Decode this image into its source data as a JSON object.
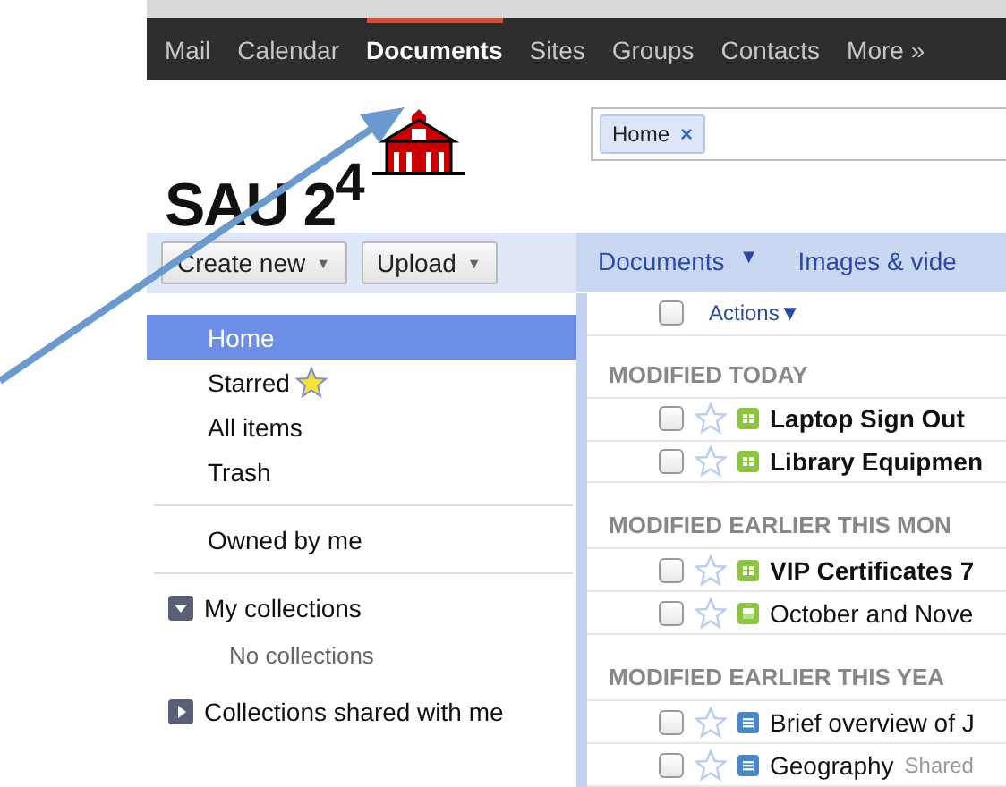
{
  "nav": {
    "items": [
      {
        "label": "Mail",
        "selected": false
      },
      {
        "label": "Calendar",
        "selected": false
      },
      {
        "label": "Documents",
        "selected": true
      },
      {
        "label": "Sites",
        "selected": false
      },
      {
        "label": "Groups",
        "selected": false
      },
      {
        "label": "Contacts",
        "selected": false
      },
      {
        "label": "More »",
        "selected": false
      }
    ]
  },
  "logo": {
    "text": "SAU 2$^{4}$"
  },
  "search": {
    "chip": "Home",
    "chip_close": "×"
  },
  "toolbar": {
    "buttons": [
      "Create new",
      "Upload"
    ],
    "caret": "▼"
  },
  "view_tabs": [
    {
      "label": "Documents",
      "caret": "▼"
    },
    {
      "label": "Images & vide"
    }
  ],
  "sidebar": {
    "items": [
      {
        "kind": "item",
        "label": "Home",
        "selected": true
      },
      {
        "kind": "item",
        "label": "Starred",
        "selected": false,
        "star": true
      },
      {
        "kind": "item",
        "label": "All items",
        "selected": false
      },
      {
        "kind": "item",
        "label": "Trash",
        "selected": false
      },
      {
        "kind": "divider"
      },
      {
        "kind": "item",
        "label": "Owned by me",
        "selected": false
      },
      {
        "kind": "divider"
      },
      {
        "kind": "group",
        "label": "My collections",
        "expanded": true,
        "empty_text": "No collections"
      },
      {
        "kind": "group",
        "label": "Collections shared with me",
        "expanded": false
      }
    ]
  },
  "list": {
    "actions": "Actions▼",
    "select_all": false,
    "sections": [
      {
        "heading": "MODIFIED TODAY",
        "rows": [
          {
            "title": "Laptop Sign Out",
            "kind": "spreadsheet",
            "unread": true,
            "checked": false,
            "starred": false
          },
          {
            "title": "Library Equipmen",
            "kind": "spreadsheet",
            "unread": true,
            "checked": false,
            "starred": false
          }
        ]
      },
      {
        "heading": "MODIFIED EARLIER THIS MON",
        "rows": [
          {
            "title": "VIP Certificates 7",
            "kind": "spreadsheet",
            "unread": true,
            "checked": false,
            "starred": false
          },
          {
            "title": "October and Nove",
            "kind": "form",
            "unread": false,
            "checked": false,
            "starred": false
          }
        ]
      },
      {
        "heading": "MODIFIED EARLIER THIS YEA",
        "rows": [
          {
            "title": "Brief overview of J",
            "kind": "document",
            "unread": false,
            "checked": false,
            "starred": false
          },
          {
            "title": "Geography",
            "kind": "document",
            "unread": false,
            "checked": false,
            "starred": false,
            "note": "Shared"
          }
        ]
      }
    ]
  }
}
